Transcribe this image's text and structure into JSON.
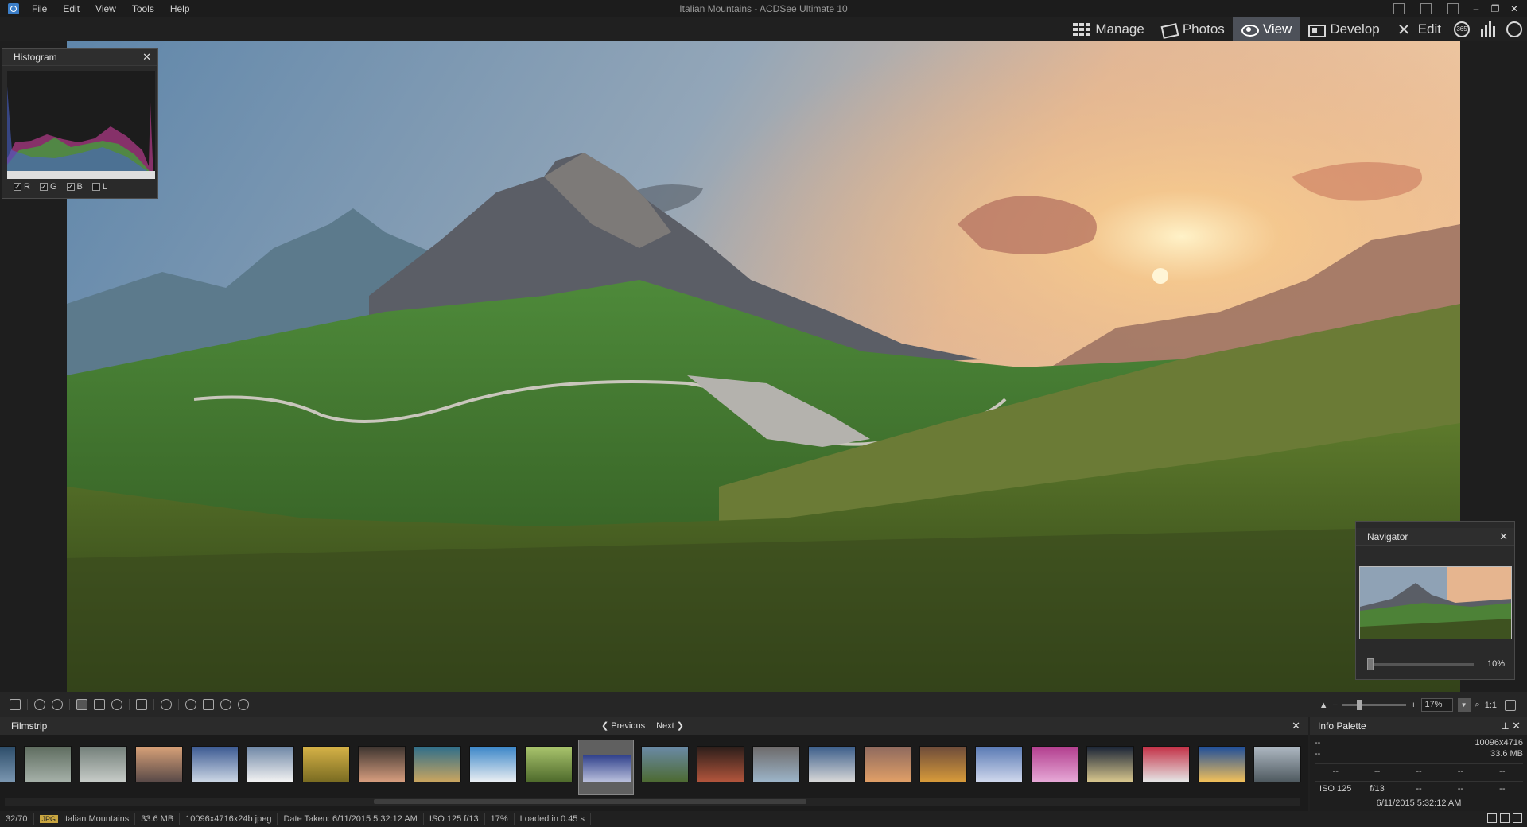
{
  "app": {
    "window_title": "Italian Mountains - ACDSee Ultimate 10",
    "menu": [
      "File",
      "Edit",
      "View",
      "Tools",
      "Help"
    ]
  },
  "modes": {
    "items": [
      {
        "label": "Manage",
        "icon": "grid-icon"
      },
      {
        "label": "Photos",
        "icon": "photos-icon"
      },
      {
        "label": "View",
        "icon": "eye-icon",
        "active": true
      },
      {
        "label": "Develop",
        "icon": "develop-icon"
      },
      {
        "label": "Edit",
        "icon": "edit-icon"
      }
    ],
    "extra_icon_365": "365"
  },
  "histogram": {
    "title": "Histogram",
    "channels": [
      {
        "label": "R",
        "checked": true
      },
      {
        "label": "G",
        "checked": true
      },
      {
        "label": "B",
        "checked": true
      },
      {
        "label": "L",
        "checked": false
      }
    ]
  },
  "navigator": {
    "title": "Navigator",
    "zoom": "10%"
  },
  "toolbar": {
    "zoom_out": "−",
    "zoom_in": "+",
    "zoom_value": "17%",
    "actual_size": "1:1"
  },
  "filmstrip": {
    "title": "Filmstrip",
    "previous_label": "Previous",
    "next_label": "Next",
    "selected_index": 11,
    "thumb_colors": [
      [
        "#2d4d6a",
        "#7a96b0"
      ],
      [
        "#5f6d60",
        "#a5b0a8"
      ],
      [
        "#74807a",
        "#c6cbc7"
      ],
      [
        "#d7a178",
        "#5a4a48"
      ],
      [
        "#3c5a92",
        "#cbd6e4"
      ],
      [
        "#6f87a6",
        "#f2f2f2"
      ],
      [
        "#d6b247",
        "#7a6c22"
      ],
      [
        "#3e3530",
        "#d69d7e"
      ],
      [
        "#2f6e8a",
        "#c9a560"
      ],
      [
        "#3b86c8",
        "#e9eef2"
      ],
      [
        "#a9c46d",
        "#4f6b2c"
      ],
      [
        "#2d3e8a",
        "#b9bfdc"
      ],
      [
        "#6a8aa6",
        "#4d6a32"
      ],
      [
        "#2c1e1a",
        "#b2553c"
      ],
      [
        "#6d6a6a",
        "#9cb4c8"
      ],
      [
        "#3c5e8a",
        "#d7d7d7"
      ],
      [
        "#8f6a5e",
        "#e09f67"
      ],
      [
        "#6e4c3a",
        "#d79a3a"
      ],
      [
        "#5a7ab4",
        "#cfd7ec"
      ],
      [
        "#b23e8e",
        "#e6a8d6"
      ],
      [
        "#1a2436",
        "#d7c68d"
      ],
      [
        "#c33046",
        "#e5e5e5"
      ],
      [
        "#1e4e9a",
        "#f1c05a"
      ],
      [
        "#aeb8c2",
        "#4f5a60"
      ],
      [
        "#2a2f6a",
        "#6a7ab0"
      ]
    ]
  },
  "info_palette": {
    "title": "Info Palette",
    "row1_left": "--",
    "row1_right": "10096x4716",
    "row2_left": "--",
    "row2_right": "33.6 MB",
    "grid1": [
      "--",
      "--",
      "--",
      "--",
      "--"
    ],
    "grid2": [
      "ISO 125",
      "f/13",
      "--",
      "--",
      "--"
    ],
    "date": "6/11/2015 5:32:12 AM"
  },
  "status": {
    "position": "32/70",
    "format_badge": "JPG",
    "name": "Italian Mountains",
    "size": "33.6 MB",
    "dimensions": "10096x4716x24b jpeg",
    "date_taken": "Date Taken: 6/11/2015 5:32:12 AM",
    "exposure": "ISO 125  f/13",
    "zoom": "17%",
    "load_time": "Loaded in 0.45 s"
  }
}
